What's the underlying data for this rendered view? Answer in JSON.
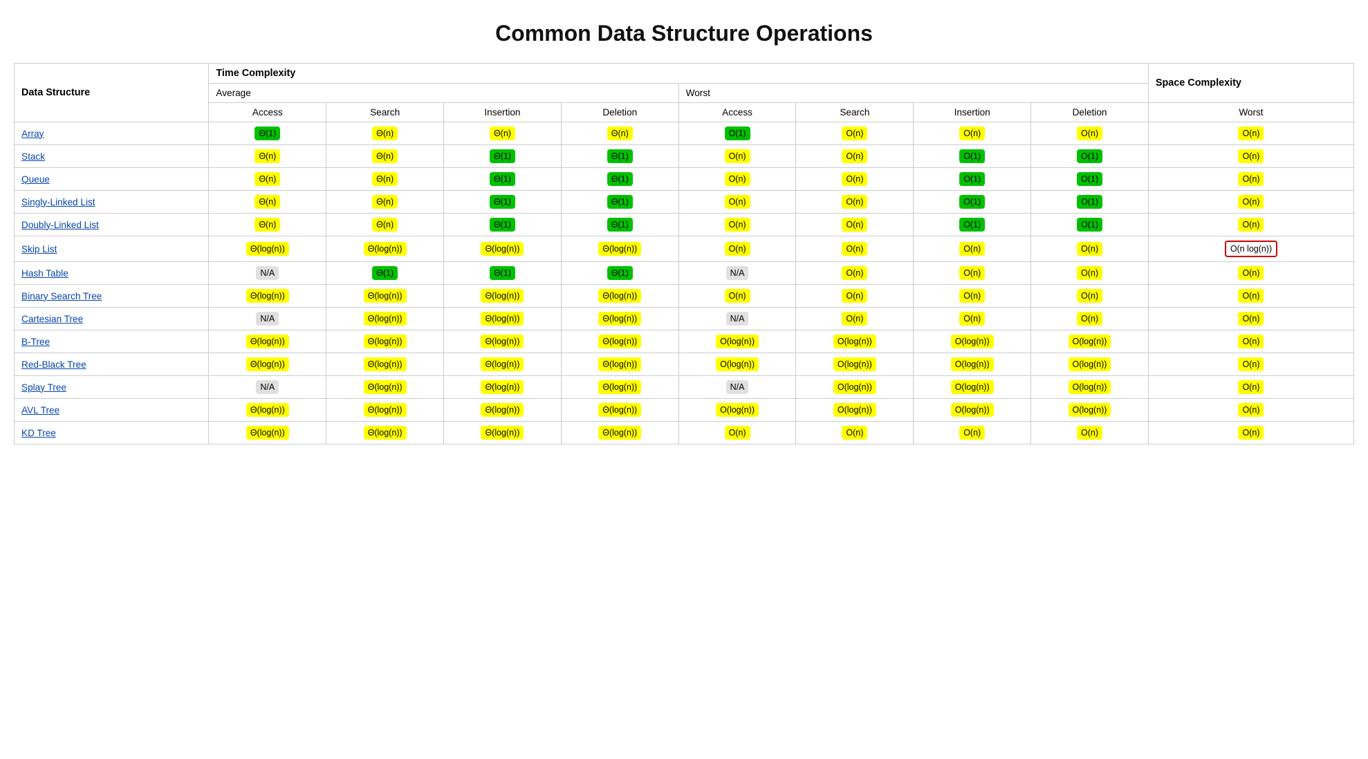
{
  "title": "Common Data Structure Operations",
  "headers": {
    "dataStructure": "Data Structure",
    "timeComplexity": "Time Complexity",
    "spaceComplexity": "Space Complexity",
    "average": "Average",
    "worst": "Worst",
    "worstSpace": "Worst",
    "cols": [
      "Access",
      "Search",
      "Insertion",
      "Deletion"
    ]
  },
  "rows": [
    {
      "name": "Array",
      "href": "#",
      "avg": [
        {
          "label": "Θ(1)",
          "color": "green"
        },
        {
          "label": "Θ(n)",
          "color": "yellow"
        },
        {
          "label": "Θ(n)",
          "color": "yellow"
        },
        {
          "label": "Θ(n)",
          "color": "yellow"
        }
      ],
      "worst": [
        {
          "label": "O(1)",
          "color": "green"
        },
        {
          "label": "O(n)",
          "color": "yellow"
        },
        {
          "label": "O(n)",
          "color": "yellow"
        },
        {
          "label": "O(n)",
          "color": "yellow"
        }
      ],
      "space": {
        "label": "O(n)",
        "color": "yellow"
      }
    },
    {
      "name": "Stack",
      "href": "#",
      "avg": [
        {
          "label": "Θ(n)",
          "color": "yellow"
        },
        {
          "label": "Θ(n)",
          "color": "yellow"
        },
        {
          "label": "Θ(1)",
          "color": "green"
        },
        {
          "label": "Θ(1)",
          "color": "green"
        }
      ],
      "worst": [
        {
          "label": "O(n)",
          "color": "yellow"
        },
        {
          "label": "O(n)",
          "color": "yellow"
        },
        {
          "label": "O(1)",
          "color": "green"
        },
        {
          "label": "O(1)",
          "color": "green"
        }
      ],
      "space": {
        "label": "O(n)",
        "color": "yellow"
      }
    },
    {
      "name": "Queue",
      "href": "#",
      "avg": [
        {
          "label": "Θ(n)",
          "color": "yellow"
        },
        {
          "label": "Θ(n)",
          "color": "yellow"
        },
        {
          "label": "Θ(1)",
          "color": "green"
        },
        {
          "label": "Θ(1)",
          "color": "green"
        }
      ],
      "worst": [
        {
          "label": "O(n)",
          "color": "yellow"
        },
        {
          "label": "O(n)",
          "color": "yellow"
        },
        {
          "label": "O(1)",
          "color": "green"
        },
        {
          "label": "O(1)",
          "color": "green"
        }
      ],
      "space": {
        "label": "O(n)",
        "color": "yellow"
      }
    },
    {
      "name": "Singly-Linked List",
      "href": "#",
      "avg": [
        {
          "label": "Θ(n)",
          "color": "yellow"
        },
        {
          "label": "Θ(n)",
          "color": "yellow"
        },
        {
          "label": "Θ(1)",
          "color": "green"
        },
        {
          "label": "Θ(1)",
          "color": "green"
        }
      ],
      "worst": [
        {
          "label": "O(n)",
          "color": "yellow"
        },
        {
          "label": "O(n)",
          "color": "yellow"
        },
        {
          "label": "O(1)",
          "color": "green"
        },
        {
          "label": "O(1)",
          "color": "green"
        }
      ],
      "space": {
        "label": "O(n)",
        "color": "yellow"
      }
    },
    {
      "name": "Doubly-Linked List",
      "href": "#",
      "avg": [
        {
          "label": "Θ(n)",
          "color": "yellow"
        },
        {
          "label": "Θ(n)",
          "color": "yellow"
        },
        {
          "label": "Θ(1)",
          "color": "green"
        },
        {
          "label": "Θ(1)",
          "color": "green"
        }
      ],
      "worst": [
        {
          "label": "O(n)",
          "color": "yellow"
        },
        {
          "label": "O(n)",
          "color": "yellow"
        },
        {
          "label": "O(1)",
          "color": "green"
        },
        {
          "label": "O(1)",
          "color": "green"
        }
      ],
      "space": {
        "label": "O(n)",
        "color": "yellow"
      }
    },
    {
      "name": "Skip List",
      "href": "#",
      "avg": [
        {
          "label": "Θ(log(n))",
          "color": "yellow"
        },
        {
          "label": "Θ(log(n))",
          "color": "yellow"
        },
        {
          "label": "Θ(log(n))",
          "color": "yellow"
        },
        {
          "label": "Θ(log(n))",
          "color": "yellow"
        }
      ],
      "worst": [
        {
          "label": "O(n)",
          "color": "yellow"
        },
        {
          "label": "O(n)",
          "color": "yellow"
        },
        {
          "label": "O(n)",
          "color": "yellow"
        },
        {
          "label": "O(n)",
          "color": "yellow"
        }
      ],
      "space": {
        "label": "O(n log(n))",
        "color": "red-border"
      }
    },
    {
      "name": "Hash Table",
      "href": "#",
      "avg": [
        {
          "label": "N/A",
          "color": "gray"
        },
        {
          "label": "Θ(1)",
          "color": "green"
        },
        {
          "label": "Θ(1)",
          "color": "green"
        },
        {
          "label": "Θ(1)",
          "color": "green"
        }
      ],
      "worst": [
        {
          "label": "N/A",
          "color": "gray"
        },
        {
          "label": "O(n)",
          "color": "yellow"
        },
        {
          "label": "O(n)",
          "color": "yellow"
        },
        {
          "label": "O(n)",
          "color": "yellow"
        }
      ],
      "space": {
        "label": "O(n)",
        "color": "yellow"
      }
    },
    {
      "name": "Binary Search Tree",
      "href": "#",
      "avg": [
        {
          "label": "Θ(log(n))",
          "color": "yellow"
        },
        {
          "label": "Θ(log(n))",
          "color": "yellow"
        },
        {
          "label": "Θ(log(n))",
          "color": "yellow"
        },
        {
          "label": "Θ(log(n))",
          "color": "yellow"
        }
      ],
      "worst": [
        {
          "label": "O(n)",
          "color": "yellow"
        },
        {
          "label": "O(n)",
          "color": "yellow"
        },
        {
          "label": "O(n)",
          "color": "yellow"
        },
        {
          "label": "O(n)",
          "color": "yellow"
        }
      ],
      "space": {
        "label": "O(n)",
        "color": "yellow"
      }
    },
    {
      "name": "Cartesian Tree",
      "href": "#",
      "avg": [
        {
          "label": "N/A",
          "color": "gray"
        },
        {
          "label": "Θ(log(n))",
          "color": "yellow"
        },
        {
          "label": "Θ(log(n))",
          "color": "yellow"
        },
        {
          "label": "Θ(log(n))",
          "color": "yellow"
        }
      ],
      "worst": [
        {
          "label": "N/A",
          "color": "gray"
        },
        {
          "label": "O(n)",
          "color": "yellow"
        },
        {
          "label": "O(n)",
          "color": "yellow"
        },
        {
          "label": "O(n)",
          "color": "yellow"
        }
      ],
      "space": {
        "label": "O(n)",
        "color": "yellow"
      }
    },
    {
      "name": "B-Tree",
      "href": "#",
      "avg": [
        {
          "label": "Θ(log(n))",
          "color": "yellow"
        },
        {
          "label": "Θ(log(n))",
          "color": "yellow"
        },
        {
          "label": "Θ(log(n))",
          "color": "yellow"
        },
        {
          "label": "Θ(log(n))",
          "color": "yellow"
        }
      ],
      "worst": [
        {
          "label": "O(log(n))",
          "color": "yellow"
        },
        {
          "label": "O(log(n))",
          "color": "yellow"
        },
        {
          "label": "O(log(n))",
          "color": "yellow"
        },
        {
          "label": "O(log(n))",
          "color": "yellow"
        }
      ],
      "space": {
        "label": "O(n)",
        "color": "yellow"
      }
    },
    {
      "name": "Red-Black Tree",
      "href": "#",
      "avg": [
        {
          "label": "Θ(log(n))",
          "color": "yellow"
        },
        {
          "label": "Θ(log(n))",
          "color": "yellow"
        },
        {
          "label": "Θ(log(n))",
          "color": "yellow"
        },
        {
          "label": "Θ(log(n))",
          "color": "yellow"
        }
      ],
      "worst": [
        {
          "label": "O(log(n))",
          "color": "yellow"
        },
        {
          "label": "O(log(n))",
          "color": "yellow"
        },
        {
          "label": "O(log(n))",
          "color": "yellow"
        },
        {
          "label": "O(log(n))",
          "color": "yellow"
        }
      ],
      "space": {
        "label": "O(n)",
        "color": "yellow"
      }
    },
    {
      "name": "Splay Tree",
      "href": "#",
      "avg": [
        {
          "label": "N/A",
          "color": "gray"
        },
        {
          "label": "Θ(log(n))",
          "color": "yellow"
        },
        {
          "label": "Θ(log(n))",
          "color": "yellow"
        },
        {
          "label": "Θ(log(n))",
          "color": "yellow"
        }
      ],
      "worst": [
        {
          "label": "N/A",
          "color": "gray"
        },
        {
          "label": "O(log(n))",
          "color": "yellow"
        },
        {
          "label": "O(log(n))",
          "color": "yellow"
        },
        {
          "label": "O(log(n))",
          "color": "yellow"
        }
      ],
      "space": {
        "label": "O(n)",
        "color": "yellow"
      }
    },
    {
      "name": "AVL Tree",
      "href": "#",
      "avg": [
        {
          "label": "Θ(log(n))",
          "color": "yellow"
        },
        {
          "label": "Θ(log(n))",
          "color": "yellow"
        },
        {
          "label": "Θ(log(n))",
          "color": "yellow"
        },
        {
          "label": "Θ(log(n))",
          "color": "yellow"
        }
      ],
      "worst": [
        {
          "label": "O(log(n))",
          "color": "yellow"
        },
        {
          "label": "O(log(n))",
          "color": "yellow"
        },
        {
          "label": "O(log(n))",
          "color": "yellow"
        },
        {
          "label": "O(log(n))",
          "color": "yellow"
        }
      ],
      "space": {
        "label": "O(n)",
        "color": "yellow"
      }
    },
    {
      "name": "KD Tree",
      "href": "#",
      "avg": [
        {
          "label": "Θ(log(n))",
          "color": "yellow"
        },
        {
          "label": "Θ(log(n))",
          "color": "yellow"
        },
        {
          "label": "Θ(log(n))",
          "color": "yellow"
        },
        {
          "label": "Θ(log(n))",
          "color": "yellow"
        }
      ],
      "worst": [
        {
          "label": "O(n)",
          "color": "yellow"
        },
        {
          "label": "O(n)",
          "color": "yellow"
        },
        {
          "label": "O(n)",
          "color": "yellow"
        },
        {
          "label": "O(n)",
          "color": "yellow"
        }
      ],
      "space": {
        "label": "O(n)",
        "color": "yellow"
      }
    }
  ]
}
